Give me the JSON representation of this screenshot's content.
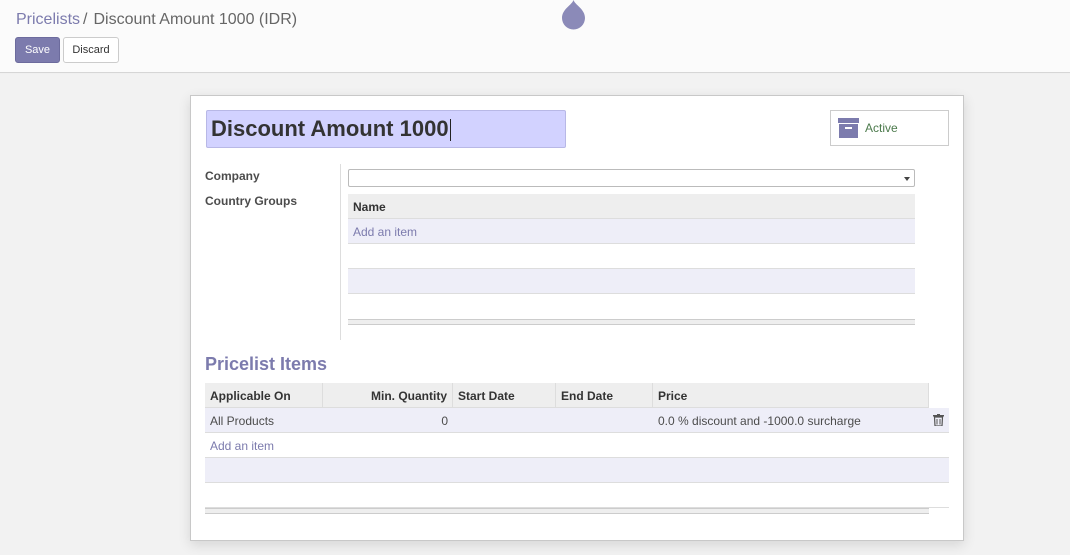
{
  "breadcrumb": {
    "parent": "Pricelists",
    "separator": "/",
    "current": "Discount Amount 1000 (IDR)"
  },
  "toolbar": {
    "save_label": "Save",
    "discard_label": "Discard"
  },
  "form": {
    "name_value": "Discount Amount 1000",
    "active_label": "Active",
    "company_label": "Company",
    "company_value": "",
    "country_groups_label": "Country Groups",
    "country_groups": {
      "column_name": "Name",
      "add_item": "Add an item"
    }
  },
  "pricelist_items": {
    "section_title": "Pricelist Items",
    "columns": [
      "Applicable On",
      "Min. Quantity",
      "Start Date",
      "End Date",
      "Price"
    ],
    "rows": [
      {
        "applicable_on": "All Products",
        "min_quantity": "0",
        "start_date": "",
        "end_date": "",
        "price": "0.0 % discount and -1000.0 surcharge"
      }
    ],
    "add_item": "Add an item"
  },
  "colors": {
    "accent": "#7c7bad",
    "active": "#4c7a4c",
    "input_highlight": "#d2d2ff"
  }
}
